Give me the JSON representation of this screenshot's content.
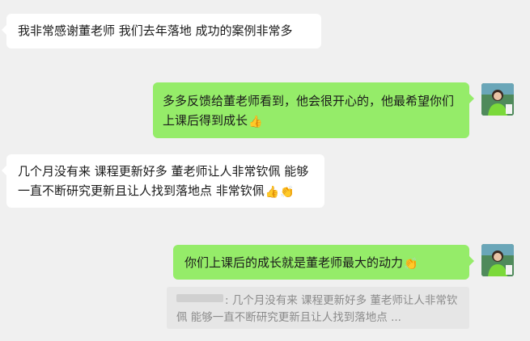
{
  "colors": {
    "background": "#f0f0f0",
    "incoming_bubble": "#ffffff",
    "outgoing_bubble": "#95ec69",
    "quote_background": "#e6e6e6",
    "quote_text": "#8a8a8a"
  },
  "messages": [
    {
      "side": "left",
      "text": "我非常感谢董老师  我们去年落地 成功的案例非常多",
      "emojis": []
    },
    {
      "side": "right",
      "text": "多多反馈给董老师看到，他会很开心的，他最希望你们上课后得到成长",
      "emojis": [
        "thumbs-up"
      ]
    },
    {
      "side": "left",
      "text": "几个月没有来  课程更新好多  董老师让人非常钦佩 能够一直不断研究更新且让人找到落地点  非常钦佩",
      "emojis": [
        "thumbs-up",
        "clap"
      ]
    },
    {
      "side": "right",
      "text": "你们上课后的成长就是董老师最大的动力",
      "emojis": [
        "clap"
      ]
    }
  ],
  "quote": {
    "text": ": 几个月没有来  课程更新好多  董老师让人非常钦佩 能够一直不断研究更新且让人找到落地点  ..."
  },
  "icons": {
    "thumbs_up": "👍",
    "clap": "👏"
  }
}
